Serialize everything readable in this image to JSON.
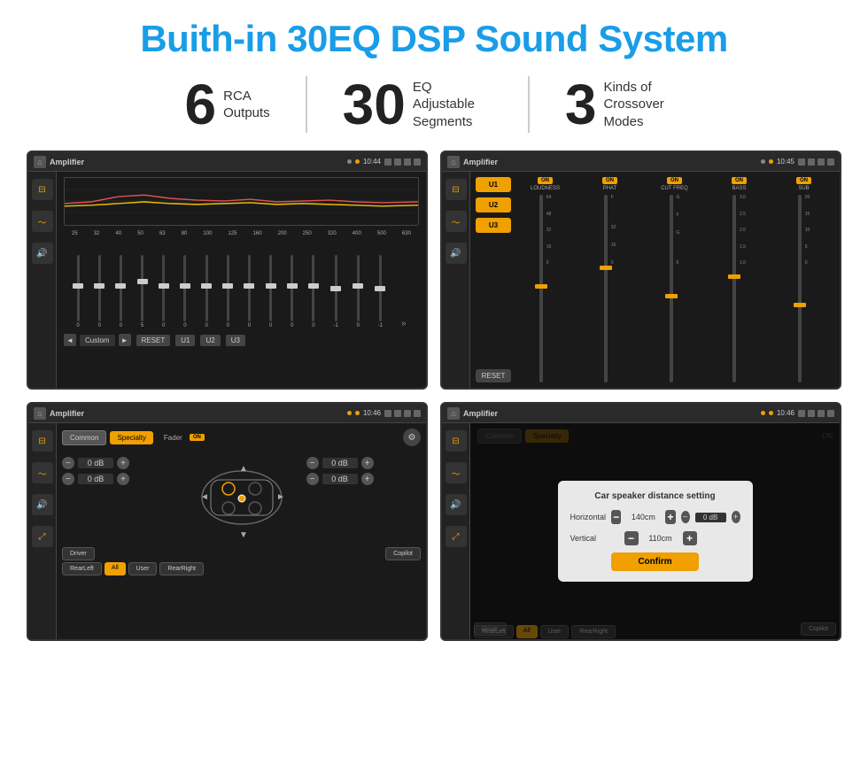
{
  "page": {
    "title": "Buith-in 30EQ DSP Sound System",
    "stats": [
      {
        "number": "6",
        "label": "RCA\nOutputs"
      },
      {
        "number": "30",
        "label": "EQ Adjustable\nSegments"
      },
      {
        "number": "3",
        "label": "Kinds of\nCrossover Modes"
      }
    ],
    "screens": [
      {
        "id": "screen1",
        "topbar": {
          "title": "Amplifier",
          "time": "10:44"
        },
        "type": "eq",
        "eq_labels": [
          "25",
          "32",
          "40",
          "50",
          "63",
          "80",
          "100",
          "125",
          "160",
          "200",
          "250",
          "320",
          "400",
          "500",
          "630"
        ],
        "eq_values": [
          "0",
          "0",
          "0",
          "5",
          "0",
          "0",
          "0",
          "0",
          "0",
          "0",
          "0",
          "0",
          "-1",
          "0",
          "-1"
        ],
        "bottom_buttons": [
          "Custom",
          "RESET",
          "U1",
          "U2",
          "U3"
        ]
      },
      {
        "id": "screen2",
        "topbar": {
          "title": "Amplifier",
          "time": "10:45"
        },
        "type": "crossover",
        "u_buttons": [
          "U1",
          "U2",
          "U3"
        ],
        "channels": [
          "LOUDNESS",
          "PHAT",
          "CUT FREQ",
          "BASS",
          "SUB"
        ],
        "channel_on": [
          true,
          true,
          true,
          true,
          true
        ],
        "reset_label": "RESET"
      },
      {
        "id": "screen3",
        "topbar": {
          "title": "Amplifier",
          "time": "10:46"
        },
        "type": "fader",
        "buttons": [
          "Common",
          "Specialty"
        ],
        "fader_label": "Fader",
        "fader_on": "ON",
        "db_values": [
          "0 dB",
          "0 dB",
          "0 dB",
          "0 dB"
        ],
        "position_buttons": [
          "Driver",
          "Copilot",
          "RearLeft",
          "All",
          "User",
          "RearRight"
        ]
      },
      {
        "id": "screen4",
        "topbar": {
          "title": "Amplifier",
          "time": "10:46"
        },
        "type": "dialog",
        "dialog": {
          "title": "Car speaker distance setting",
          "horizontal_label": "Horizontal",
          "horizontal_value": "140cm",
          "vertical_label": "Vertical",
          "vertical_value": "110cm",
          "confirm_label": "Confirm"
        },
        "buttons": [
          "Common",
          "Specialty"
        ],
        "position_buttons": [
          "Driver",
          "Copilot",
          "RearLeft",
          "All",
          "User",
          "RearRight"
        ]
      }
    ]
  }
}
